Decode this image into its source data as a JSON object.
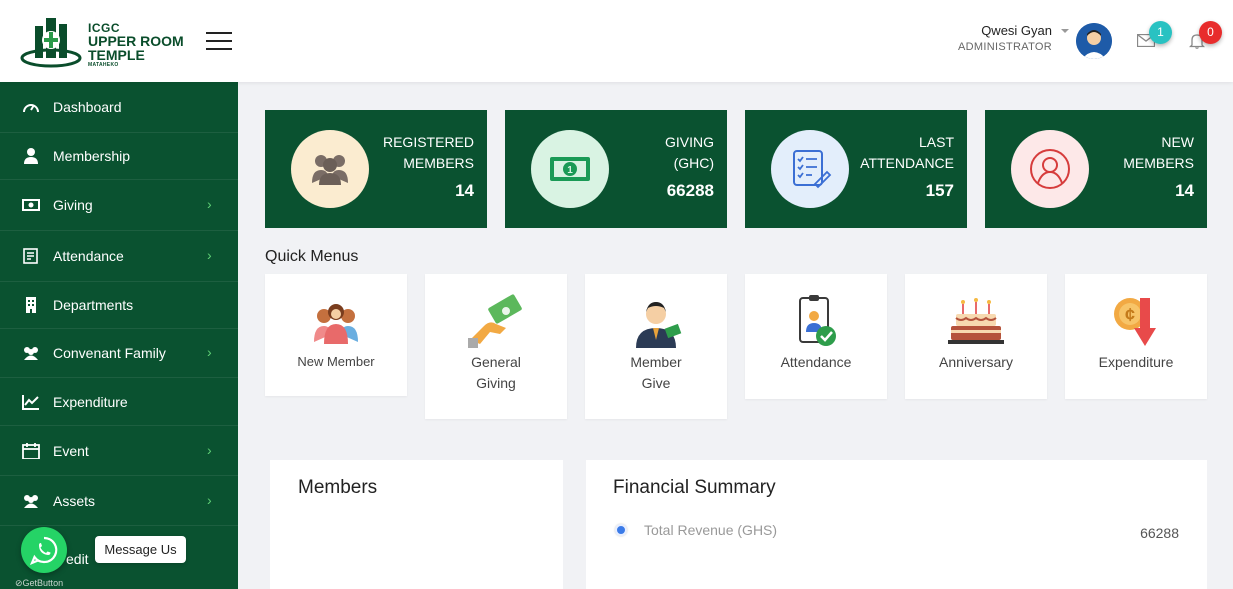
{
  "logo": {
    "line1": "ICGC",
    "line2": "UPPER ROOM",
    "line3": "TEMPLE",
    "line4": "MATAHEKO"
  },
  "header": {
    "user_name": "Qwesi Gyan",
    "user_role": "ADMINISTRATOR",
    "mail_count": "1",
    "notification_count": "0"
  },
  "sidebar": {
    "items": [
      {
        "label": "Dashboard",
        "icon": "dashboard-icon"
      },
      {
        "label": "Membership",
        "icon": "user-icon"
      },
      {
        "label": "Giving",
        "icon": "money-icon"
      },
      {
        "label": "Attendance",
        "icon": "clipboard-icon"
      },
      {
        "label": "Departments",
        "icon": "building-icon"
      },
      {
        "label": "Convenant Family",
        "icon": "users-icon"
      },
      {
        "label": "Expenditure",
        "icon": "chart-icon"
      },
      {
        "label": "Event",
        "icon": "calendar-icon"
      },
      {
        "label": "Assets",
        "icon": "users-icon"
      },
      {
        "label": "edit",
        "icon": "edit-icon"
      }
    ]
  },
  "stats": [
    {
      "line1": "REGISTERED",
      "line2": "MEMBERS",
      "value": "14"
    },
    {
      "line1": "GIVING",
      "line2": "(GHC)",
      "value": "66288"
    },
    {
      "line1": "LAST",
      "line2": "ATTENDANCE",
      "value": "157"
    },
    {
      "line1": "NEW",
      "line2": "MEMBERS",
      "value": "14"
    }
  ],
  "quick_menus": {
    "title": "Quick Menus",
    "items": [
      {
        "line1": "New Member",
        "line2": ""
      },
      {
        "line1": "General",
        "line2": "Giving"
      },
      {
        "line1": "Member",
        "line2": "Give"
      },
      {
        "line1": "Attendance",
        "line2": ""
      },
      {
        "line1": "Anniversary",
        "line2": ""
      },
      {
        "line1": "Expenditure",
        "line2": ""
      }
    ]
  },
  "members_panel": {
    "title": "Members"
  },
  "financial_panel": {
    "title": "Financial Summary",
    "legend_label": "Total Revenue (GHS)",
    "legend_value": "66288",
    "legend_color": "#3b7be8"
  },
  "whatsapp": {
    "tooltip": "Message Us",
    "brand": "GetButton"
  },
  "colors": {
    "primary": "#0a5230",
    "accent": "#5fcf75"
  }
}
